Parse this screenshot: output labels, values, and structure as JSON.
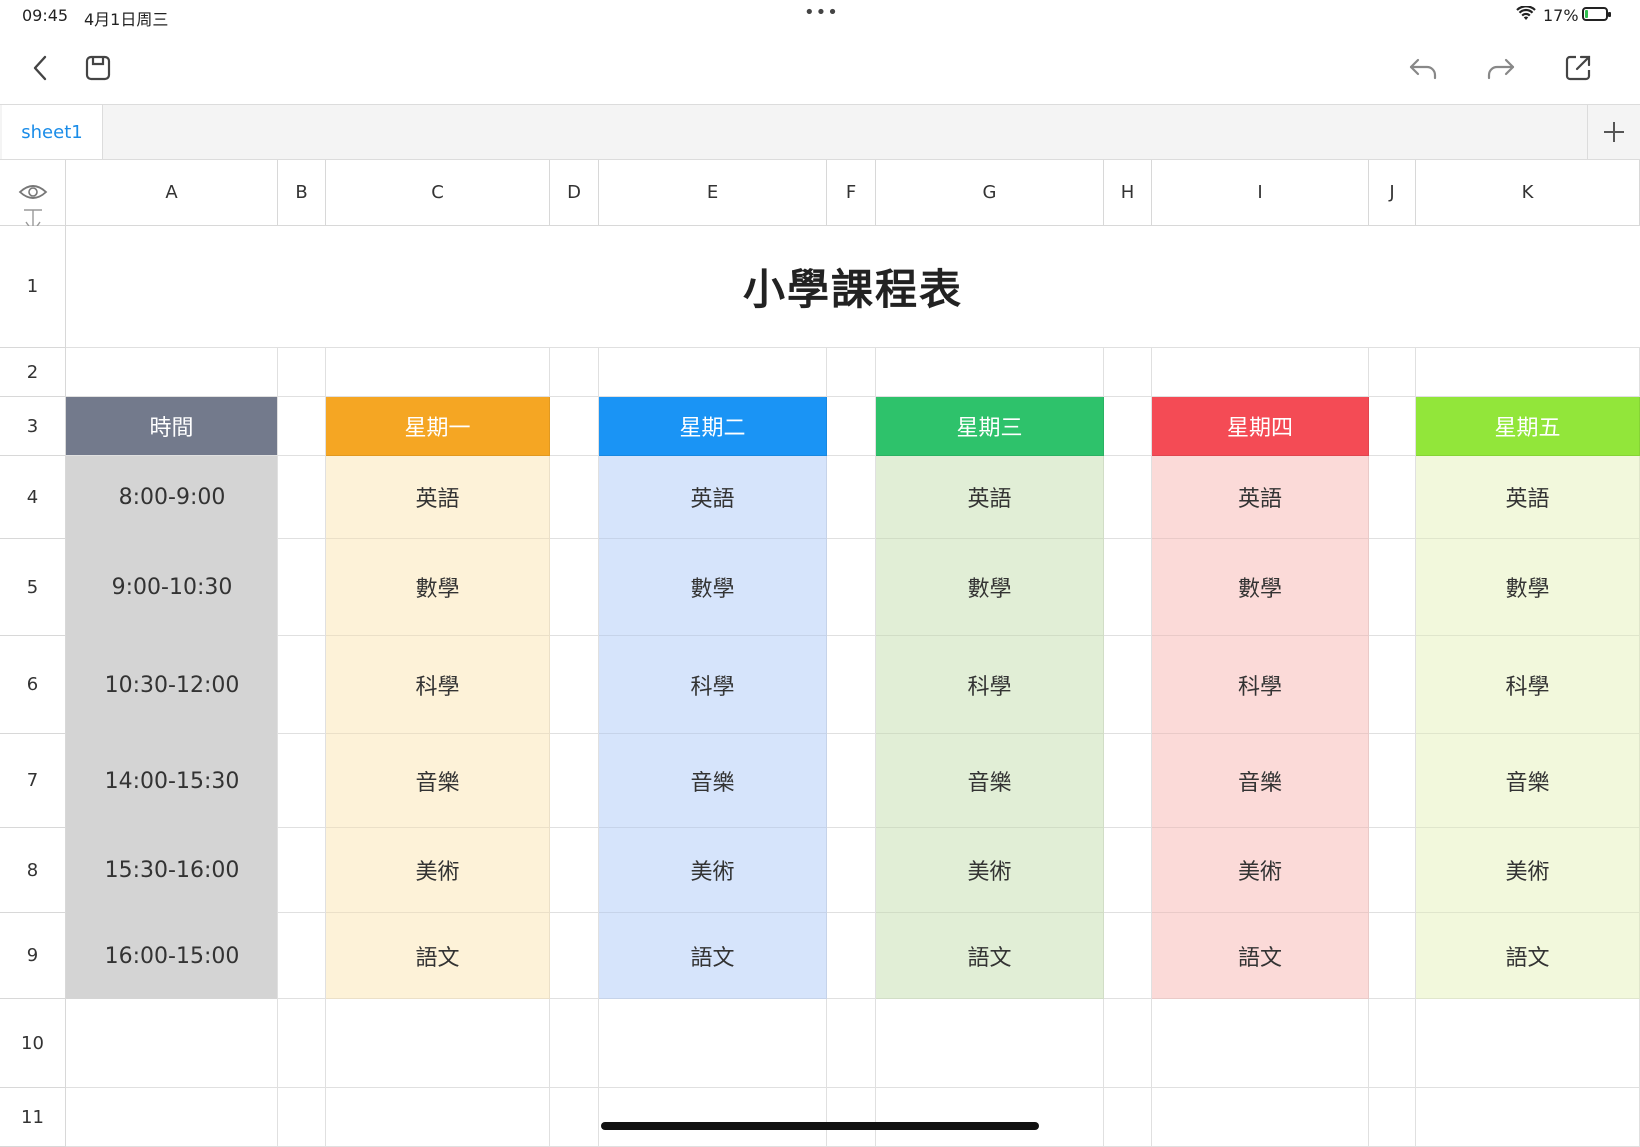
{
  "status_bar": {
    "time": "09:45",
    "date": "4月1日周三",
    "battery_percent": "17%",
    "battery_level": 0.17,
    "icons": [
      "wifi-icon",
      "battery-charging-icon",
      "more-dots-icon"
    ]
  },
  "toolbar": {
    "left": [
      "back-chevron-icon",
      "save-icon"
    ],
    "right": [
      "undo-icon",
      "redo-icon",
      "share-icon"
    ]
  },
  "tabs": {
    "items": [
      {
        "label": "sheet1",
        "active": true
      }
    ],
    "add_icon": "plus-icon"
  },
  "columns": [
    "A",
    "B",
    "C",
    "D",
    "E",
    "F",
    "G",
    "H",
    "I",
    "J",
    "K"
  ],
  "rows": [
    "1",
    "2",
    "3",
    "4",
    "5",
    "6",
    "7",
    "8",
    "9",
    "10",
    "11"
  ],
  "sheet": {
    "title": "小學課程表",
    "time_header": "時間",
    "times": [
      "8:00-9:00",
      "9:00-10:30",
      "10:30-12:00",
      "14:00-15:30",
      "15:30-16:00",
      "16:00-15:00"
    ],
    "days": [
      {
        "name": "星期一",
        "header_color": "#f5a623",
        "fill_color": "#fdf2d8",
        "subjects": [
          "英語",
          "數學",
          "科學",
          "音樂",
          "美術",
          "語文"
        ]
      },
      {
        "name": "星期二",
        "header_color": "#1a94f5",
        "fill_color": "#d6e4fb",
        "subjects": [
          "英語",
          "數學",
          "科學",
          "音樂",
          "美術",
          "語文"
        ]
      },
      {
        "name": "星期三",
        "header_color": "#2ec26b",
        "fill_color": "#e1eed6",
        "subjects": [
          "英語",
          "數學",
          "科學",
          "音樂",
          "美術",
          "語文"
        ]
      },
      {
        "name": "星期四",
        "header_color": "#f44b55",
        "fill_color": "#fbdad8",
        "subjects": [
          "英語",
          "數學",
          "科學",
          "音樂",
          "美術",
          "語文"
        ]
      },
      {
        "name": "星期五",
        "header_color": "#92e63a",
        "fill_color": "#f2f8dc",
        "subjects": [
          "英語",
          "數學",
          "科學",
          "音樂",
          "美術",
          "語文"
        ]
      }
    ],
    "time_header_color": "#737a8c",
    "time_fill_color": "#d4d4d4"
  }
}
